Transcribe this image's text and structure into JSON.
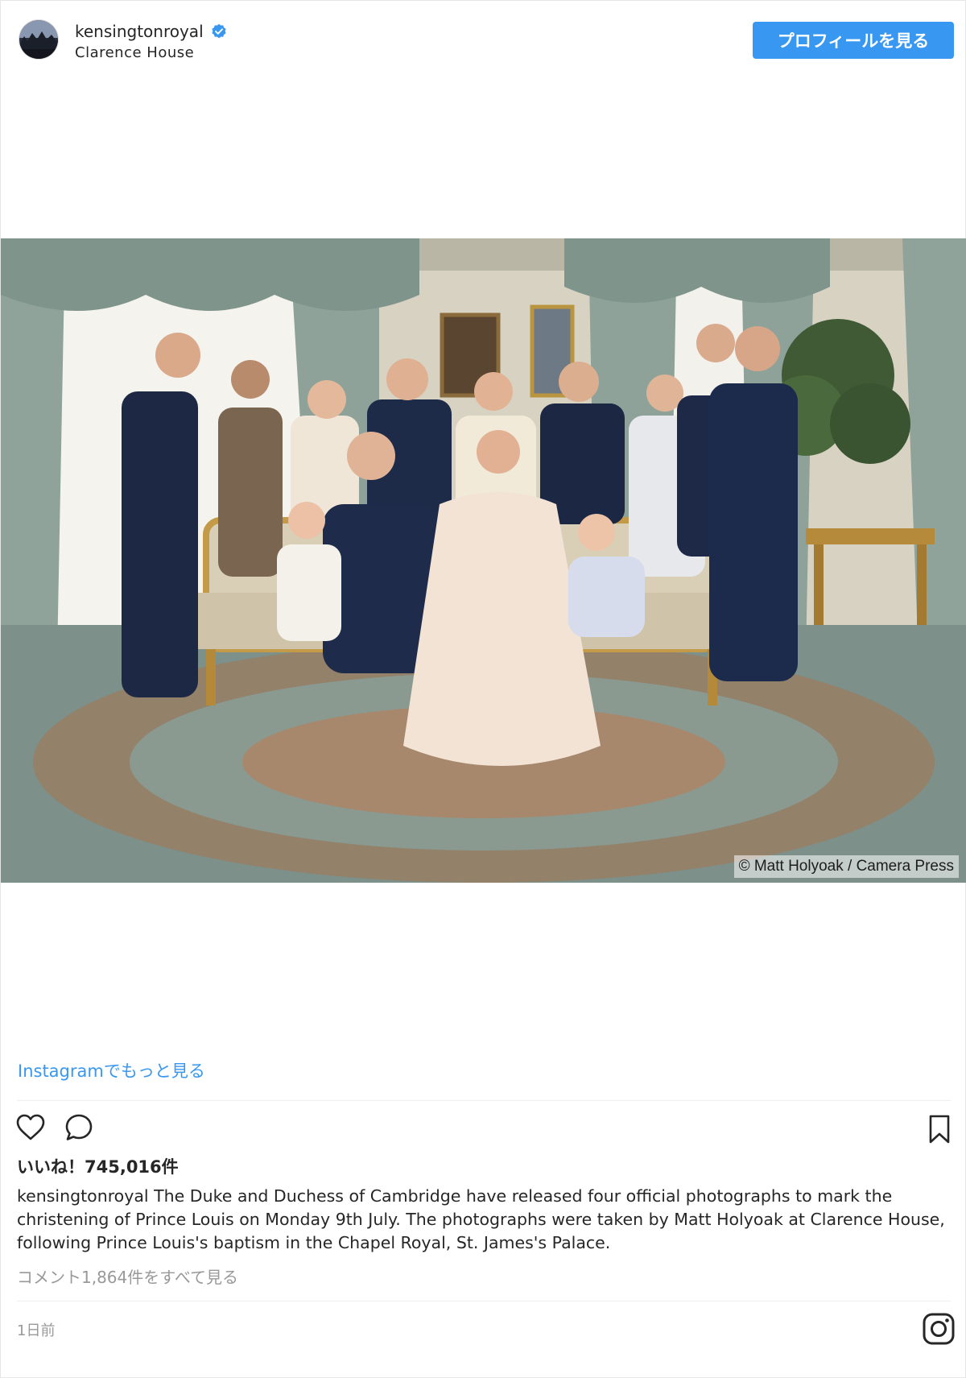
{
  "post": {
    "username": "kensingtonroyal",
    "verified": true,
    "location": "Clarence House",
    "profile_button_label": "プロフィールを見る",
    "photo_credit": "© Matt Holyoak / Camera Press",
    "more_on_instagram": "Instagramでもっと見る",
    "likes_text": "いいね！745,016件",
    "caption_user": "kensingtonroyal",
    "caption_text": "The Duke and Duchess of Cambridge have released four official photographs to mark the christening of Prince Louis on Monday 9th July. The photographs were taken by Matt Holyoak at Clarence House, following Prince Louis's baptism in the Chapel Royal, St. James's Palace.",
    "comments_link": "コメント1,864件をすべて見る",
    "timestamp": "1日前"
  },
  "icons": {
    "like": "heart-icon",
    "comment": "comment-icon",
    "save": "bookmark-icon",
    "brand": "instagram-logo-icon",
    "verified": "verified-badge-icon"
  },
  "colors": {
    "accent": "#3897f0",
    "text": "#262626",
    "muted": "#999999",
    "divider": "#efefef"
  }
}
